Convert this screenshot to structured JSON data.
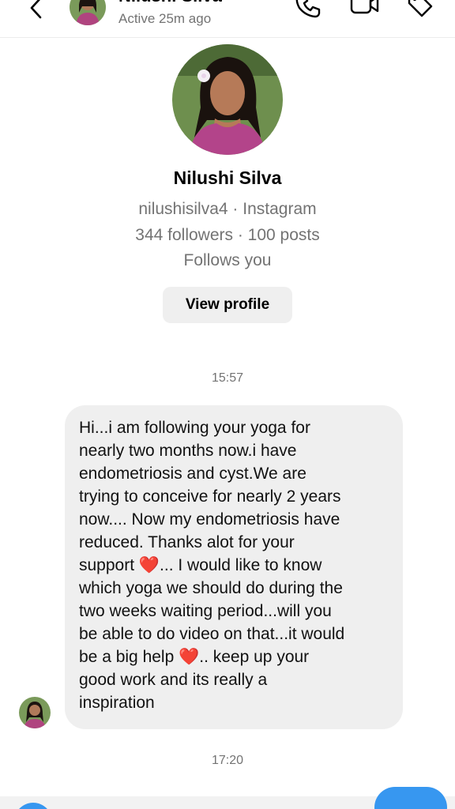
{
  "header": {
    "contact_name": "Nilushi Silva",
    "status": "Active 25m ago",
    "back_icon": "chevron-left-icon",
    "call_icon": "phone-icon",
    "video_icon": "video-camera-icon",
    "tag_icon": "tag-icon"
  },
  "profile": {
    "name": "Nilushi Silva",
    "handle_line": "nilushisilva4 · Instagram",
    "stats_line": "344 followers · 100 posts",
    "follows_line": "Follows you",
    "view_profile_label": "View profile"
  },
  "messages": {
    "timestamp_1": "15:57",
    "message_1": "Hi...i am following your yoga for\nnearly two months now.i have\nendometriosis and cyst.We are\ntrying to conceive for nearly 2 years\nnow.... Now my endometriosis have\nreduced.  Thanks alot for your\nsupport ❤️... I would like to know\nwhich yoga we should do during the\ntwo weeks waiting period...will you\nbe able to do video on that...it would\nbe a big help ❤️.. keep up your\ngood work and its really a\ninspiration",
    "timestamp_2": "17:20"
  },
  "colors": {
    "accent": "#3797f0",
    "bubble": "#efefef",
    "muted_text": "#737373"
  }
}
